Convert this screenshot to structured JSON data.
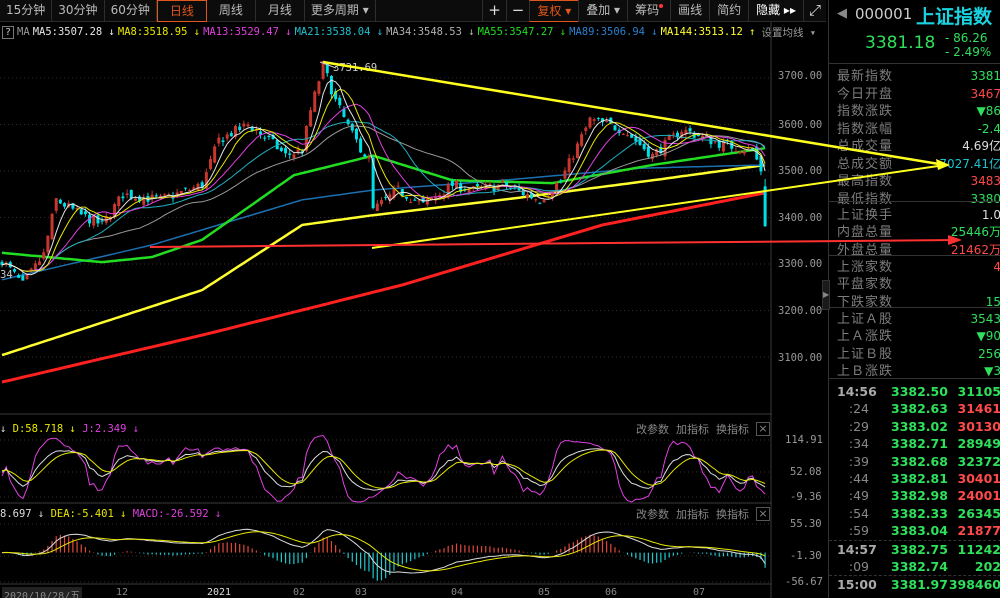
{
  "toolbar": {
    "periods": [
      "15分钟",
      "30分钟",
      "60分钟",
      "日线",
      "周线",
      "月线",
      "更多周期 ▾"
    ],
    "active_period": "日线",
    "zoom_in": "+",
    "zoom_out": "−",
    "adjust": "复权 ▾",
    "overlay": "叠加 ▾",
    "chips": "筹码",
    "draw": "画线",
    "simple": "简约",
    "hide": "隐藏 ▸▸",
    "fullscreen": "⤢"
  },
  "ma_legend": {
    "help": "?",
    "label": "MA",
    "items": [
      {
        "text": "MA5:3507.28 ↓",
        "color": "#e6e6e6"
      },
      {
        "text": "MA8:3518.95 ↓",
        "color": "#e8e800"
      },
      {
        "text": "MA13:3529.47 ↓",
        "color": "#e040e0"
      },
      {
        "text": "MA21:3538.04 ↓",
        "color": "#20c0d0"
      },
      {
        "text": "MA34:3548.53 ↓",
        "color": "#b0b0b0"
      },
      {
        "text": "MA55:3547.27 ↓",
        "color": "#22dd22"
      },
      {
        "text": "MA89:3506.94 ↓",
        "color": "#2a80d0"
      },
      {
        "text": "MA144:3513.12 ↑",
        "color": "#ffff30"
      }
    ],
    "settings": "设置均线 ▾"
  },
  "price_axis": [
    "3700.00",
    "3600.00",
    "3500.00",
    "3400.00",
    "3300.00",
    "3200.00",
    "3100.00"
  ],
  "annotations": {
    "high_label": "3731.69",
    "low_label": "34"
  },
  "kdj": {
    "head": [
      {
        "text": "↓",
        "color": "#ddd"
      },
      {
        "text": "D:58.718 ↓",
        "color": "#e8e800"
      },
      {
        "text": "J:2.349 ↓",
        "color": "#e040e0"
      }
    ],
    "axis": [
      "114.91",
      "52.08",
      "-9.36"
    ]
  },
  "macd": {
    "head": [
      {
        "text": "8.697 ↓",
        "color": "#ddd"
      },
      {
        "text": "DEA:-5.401 ↓",
        "color": "#e8e800"
      },
      {
        "text": "MACD:-26.592 ↓",
        "color": "#e040e0"
      }
    ],
    "axis": [
      "55.30",
      "-1.30",
      "-56.67"
    ]
  },
  "panel_buttons": {
    "edit": "改参数",
    "add": "加指标",
    "switch": "换指标",
    "close": "×"
  },
  "date_axis": [
    "2020/10/28/五",
    "12",
    "2021",
    "02",
    "03",
    "04",
    "05",
    "06",
    "07"
  ],
  "side": {
    "code": "000001",
    "name": "上证指数",
    "price": "3381.18",
    "change": "- 86.26",
    "change_pct": "- 2.49%",
    "info": [
      {
        "label": "最新指数",
        "value": "3381",
        "color": "#2ee05a"
      },
      {
        "label": "今日开盘",
        "value": "3467",
        "color": "#ff4a4a"
      },
      {
        "label": "指数涨跌",
        "value": "▼86",
        "color": "#2ee05a"
      },
      {
        "label": "指数涨幅",
        "value": "-2.4",
        "color": "#2ee05a"
      },
      {
        "label": "总成交量",
        "value": "4.69亿",
        "color": "#ddd"
      },
      {
        "label": "总成交额",
        "value": "7027.41亿",
        "color": "#20c0d0"
      },
      {
        "label": "最高指数",
        "value": "3483",
        "color": "#ff4a4a"
      },
      {
        "label": "最低指数",
        "value": "3380",
        "color": "#2ee05a"
      },
      {
        "label": "上证换手",
        "value": "1.0",
        "color": "#ddd"
      },
      {
        "label": "内盘总量",
        "value": "25446万",
        "color": "#2ee05a"
      },
      {
        "label": "外盘总量",
        "value": "21462万",
        "color": "#ff4a4a"
      },
      {
        "label": "上涨家数",
        "value": "4",
        "color": "#ff4a4a"
      },
      {
        "label": "平盘家数",
        "value": "",
        "color": "#ddd"
      },
      {
        "label": "下跌家数",
        "value": "15",
        "color": "#2ee05a"
      },
      {
        "label": "上证Ａ股",
        "value": "3543",
        "color": "#2ee05a"
      },
      {
        "label": "上Ａ涨跌",
        "value": "▼90",
        "color": "#2ee05a"
      },
      {
        "label": "上证Ｂ股",
        "value": "256",
        "color": "#2ee05a"
      },
      {
        "label": "上Ｂ涨跌",
        "value": "▼3",
        "color": "#2ee05a"
      }
    ],
    "ticks": [
      {
        "time": "14:56",
        "price": "3382.50",
        "vol": "31105",
        "color": "#2ee05a",
        "major": true
      },
      {
        "time": ":24",
        "price": "3382.63",
        "vol": "31461",
        "color": "#ff4a4a"
      },
      {
        "time": ":29",
        "price": "3383.02",
        "vol": "30130",
        "color": "#ff4a4a"
      },
      {
        "time": ":34",
        "price": "3382.71",
        "vol": "28949",
        "color": "#2ee05a"
      },
      {
        "time": ":39",
        "price": "3382.68",
        "vol": "32372",
        "color": "#2ee05a"
      },
      {
        "time": ":44",
        "price": "3382.81",
        "vol": "30401",
        "color": "#ff4a4a"
      },
      {
        "time": ":49",
        "price": "3382.98",
        "vol": "24001",
        "color": "#ff4a4a"
      },
      {
        "time": ":54",
        "price": "3382.33",
        "vol": "26345",
        "color": "#2ee05a"
      },
      {
        "time": ":59",
        "price": "3383.04",
        "vol": "21877",
        "color": "#ff4a4a"
      },
      {
        "time": "14:57",
        "price": "3382.75",
        "vol": "11242",
        "color": "#2ee05a",
        "major": true
      },
      {
        "time": ":09",
        "price": "3382.74",
        "vol": "202",
        "color": "#2ee05a"
      },
      {
        "time": "15:00",
        "price": "3381.97",
        "vol": "398460",
        "color": "#2ee05a",
        "major": true
      }
    ]
  },
  "chart_data": {
    "type": "candlestick",
    "days": 184,
    "price_path": [
      [
        0,
        3309
      ],
      [
        5,
        3255
      ],
      [
        10,
        3320
      ],
      [
        13,
        3438
      ],
      [
        19,
        3405
      ],
      [
        24,
        3384
      ],
      [
        29,
        3450
      ],
      [
        38,
        3438
      ],
      [
        48,
        3470
      ],
      [
        52,
        3567
      ],
      [
        59,
        3600
      ],
      [
        64,
        3567
      ],
      [
        68,
        3533
      ],
      [
        72,
        3545
      ],
      [
        74,
        3630
      ],
      [
        77,
        3728
      ],
      [
        80,
        3650
      ],
      [
        84,
        3577
      ],
      [
        88,
        3523
      ],
      [
        89,
        3416
      ],
      [
        95,
        3459
      ],
      [
        101,
        3427
      ],
      [
        108,
        3470
      ],
      [
        113,
        3459
      ],
      [
        120,
        3470
      ],
      [
        129,
        3438
      ],
      [
        134,
        3480
      ],
      [
        141,
        3610
      ],
      [
        149,
        3589
      ],
      [
        156,
        3533
      ],
      [
        163,
        3589
      ],
      [
        173,
        3556
      ],
      [
        180,
        3545
      ],
      [
        182,
        3502
      ]
    ],
    "last_candle": {
      "open": 3467,
      "high": 3483,
      "low": 3380,
      "close": 3381.18
    },
    "high": 3731.69,
    "ma55_path": [
      [
        0,
        3324
      ],
      [
        24,
        3304
      ],
      [
        36,
        3315
      ],
      [
        48,
        3352
      ],
      [
        70,
        3491
      ],
      [
        89,
        3533
      ],
      [
        108,
        3480
      ],
      [
        132,
        3474
      ],
      [
        156,
        3513
      ],
      [
        183,
        3549
      ]
    ],
    "ma89_path": [
      [
        0,
        3266
      ],
      [
        36,
        3341
      ],
      [
        72,
        3438
      ],
      [
        89,
        3459
      ],
      [
        120,
        3480
      ],
      [
        153,
        3506
      ],
      [
        183,
        3513
      ]
    ],
    "ma144_path": [
      [
        0,
        3104
      ],
      [
        48,
        3244
      ],
      [
        72,
        3384
      ],
      [
        89,
        3405
      ],
      [
        120,
        3438
      ],
      [
        156,
        3480
      ],
      [
        183,
        3513
      ]
    ],
    "ma250_path": [
      [
        0,
        3046
      ],
      [
        48,
        3147
      ],
      [
        96,
        3255
      ],
      [
        144,
        3384
      ],
      [
        183,
        3453
      ]
    ],
    "colors": {
      "up": "#c8372d",
      "down": "#00e0e8",
      "ma5": "#e6e6e6",
      "ma8": "#e8e800",
      "ma13": "#e040e0",
      "ma21": "#20b0c0",
      "ma34": "#9a9a9a",
      "ma55": "#22dd22",
      "ma89": "#1a70b0",
      "ma144": "#ffff30",
      "ma250": "#ff2020"
    }
  }
}
